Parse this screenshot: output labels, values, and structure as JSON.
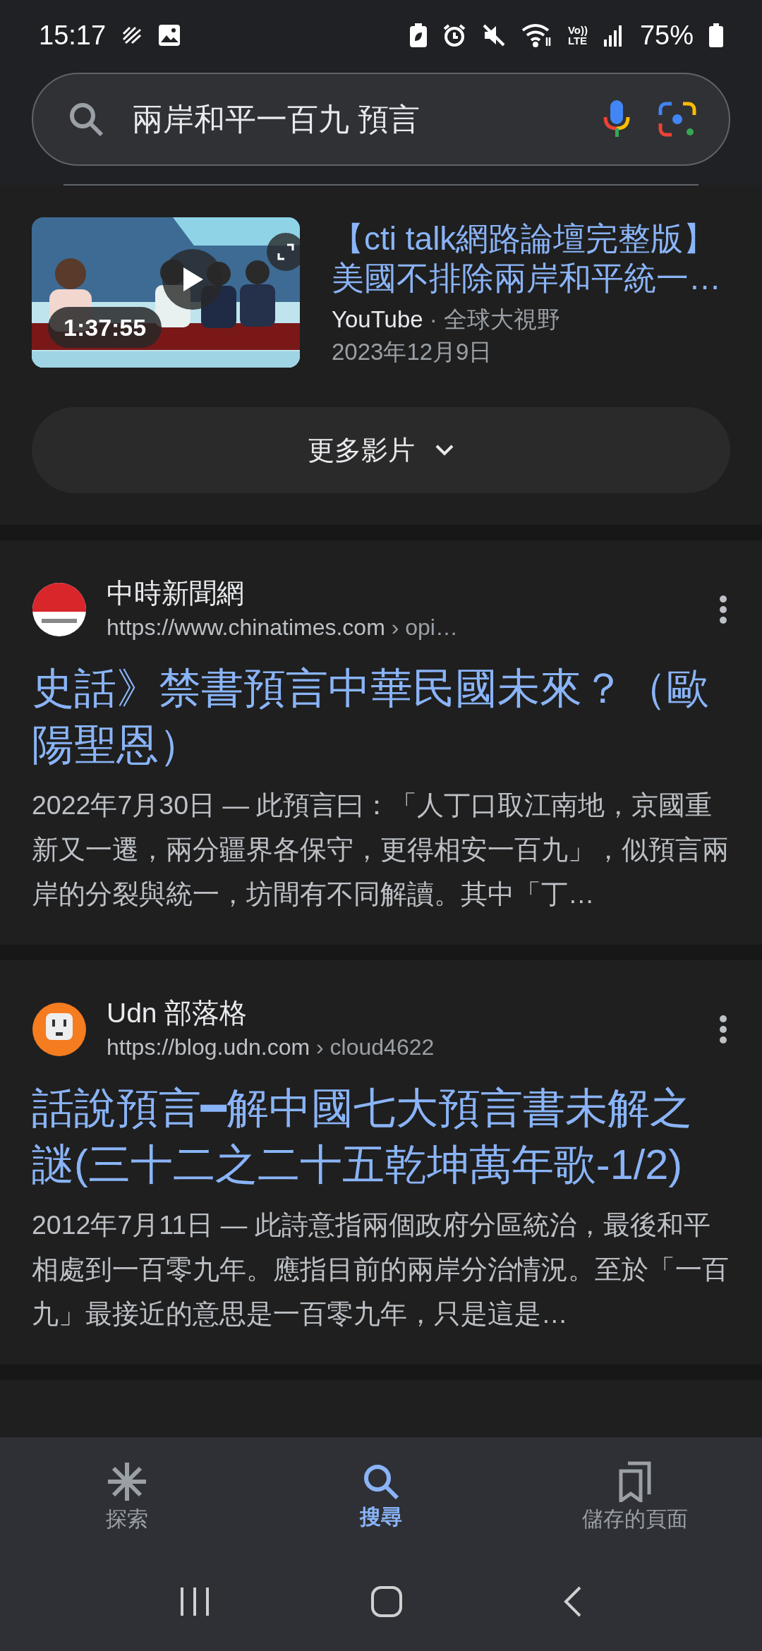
{
  "status_bar": {
    "time": "15:17",
    "network": [
      "Vo))",
      "LTE"
    ],
    "battery": "75%"
  },
  "search": {
    "value": "兩岸和平一百九 預言"
  },
  "video": {
    "title": "【cti talk網路論壇完整版】美國不排除兩岸和平統一…",
    "duration": "1:37:55",
    "source": "YouTube",
    "channel": "· 全球大視野",
    "date": "2023年12月9日"
  },
  "more_button": "更多影片",
  "results": [
    {
      "kind": "news",
      "site": "中時新聞網",
      "url": "https://www.chinatimes.com",
      "path": " › opi…",
      "title": "史話》禁書預言中華民國未來？（歐陽聖恩）",
      "snippet": "2022年7月30日 — 此預言曰：「人丁口取江南地，京國重新又一遷，兩分疆界各保守，更得相安一百九」，似預言兩岸的分裂與統一，坊間有不同解讀。其中「丁…"
    },
    {
      "kind": "blog",
      "site": "Udn 部落格",
      "url": "https://blog.udn.com",
      "path": " › cloud4622",
      "title": "話說預言━解中國七大預言書未解之謎(三十二之二十五乾坤萬年歌-1/2)",
      "snippet": "2012年7月11日 — 此詩意指兩個政府分區統治，最後和平相處到一百零九年。應指目前的兩岸分治情況。至於「一百九」最接近的意思是一百零九年，只是這是…"
    }
  ],
  "bottom_nav": [
    {
      "label": "探索",
      "selected": false
    },
    {
      "label": "搜尋",
      "selected": true
    },
    {
      "label": "儲存的頁面",
      "selected": false
    }
  ]
}
